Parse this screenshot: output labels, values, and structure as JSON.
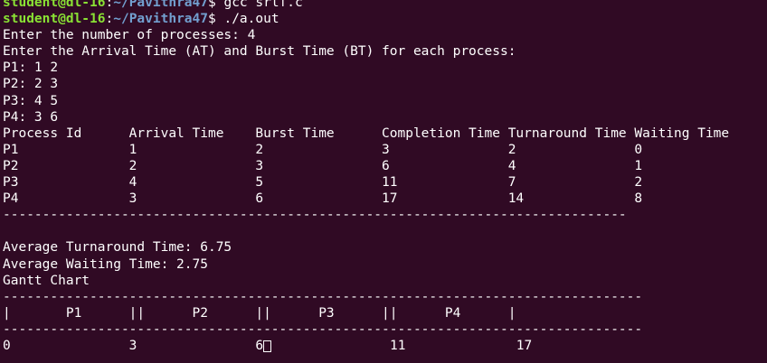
{
  "terminal": {
    "prompt_user": "student@dl-16",
    "prompt_sep": ":",
    "prompt_path": "~/Pavithra47",
    "prompt_symbol": "$ ",
    "lines": [
      {
        "kind": "prompt",
        "cmd": "gcc srtf.c"
      },
      {
        "kind": "prompt",
        "cmd": "./a.out"
      },
      {
        "kind": "text",
        "text": "Enter the number of processes: 4"
      },
      {
        "kind": "text",
        "text": "Enter the Arrival Time (AT) and Burst Time (BT) for each process:"
      },
      {
        "kind": "text",
        "text": "P1: 1 2"
      },
      {
        "kind": "text",
        "text": "P2: 2 3"
      },
      {
        "kind": "text",
        "text": "P3: 4 5"
      },
      {
        "kind": "text",
        "text": "P4: 3 6"
      },
      {
        "kind": "text",
        "text": "Process Id      Arrival Time    Burst Time      Completion Time Turnaround Time Waiting Time"
      },
      {
        "kind": "text",
        "text": "P1              1               2               3               2               0"
      },
      {
        "kind": "text",
        "text": "P2              2               3               6               4               1"
      },
      {
        "kind": "text",
        "text": "P3              4               5               11              7               2"
      },
      {
        "kind": "text",
        "text": "P4              3               6               17              14              8"
      },
      {
        "kind": "text",
        "text": "-------------------------------------------------------------------------------"
      },
      {
        "kind": "text",
        "text": ""
      },
      {
        "kind": "text",
        "text": "Average Turnaround Time: 6.75"
      },
      {
        "kind": "text",
        "text": "Average Waiting Time: 2.75"
      },
      {
        "kind": "text",
        "text": "Gantt Chart"
      },
      {
        "kind": "text",
        "text": "---------------------------------------------------------------------------------"
      },
      {
        "kind": "text",
        "text": "|       P1      ||      P2      ||      P3      ||      P4      |"
      },
      {
        "kind": "text",
        "text": "---------------------------------------------------------------------------------"
      },
      {
        "kind": "cursorline",
        "text": "0               3               6",
        "after": "               11              17"
      }
    ]
  },
  "colors": {
    "background": "#300a24",
    "prompt_user": "#8ae234",
    "prompt_path": "#729fcf",
    "text": "#ffffff"
  }
}
